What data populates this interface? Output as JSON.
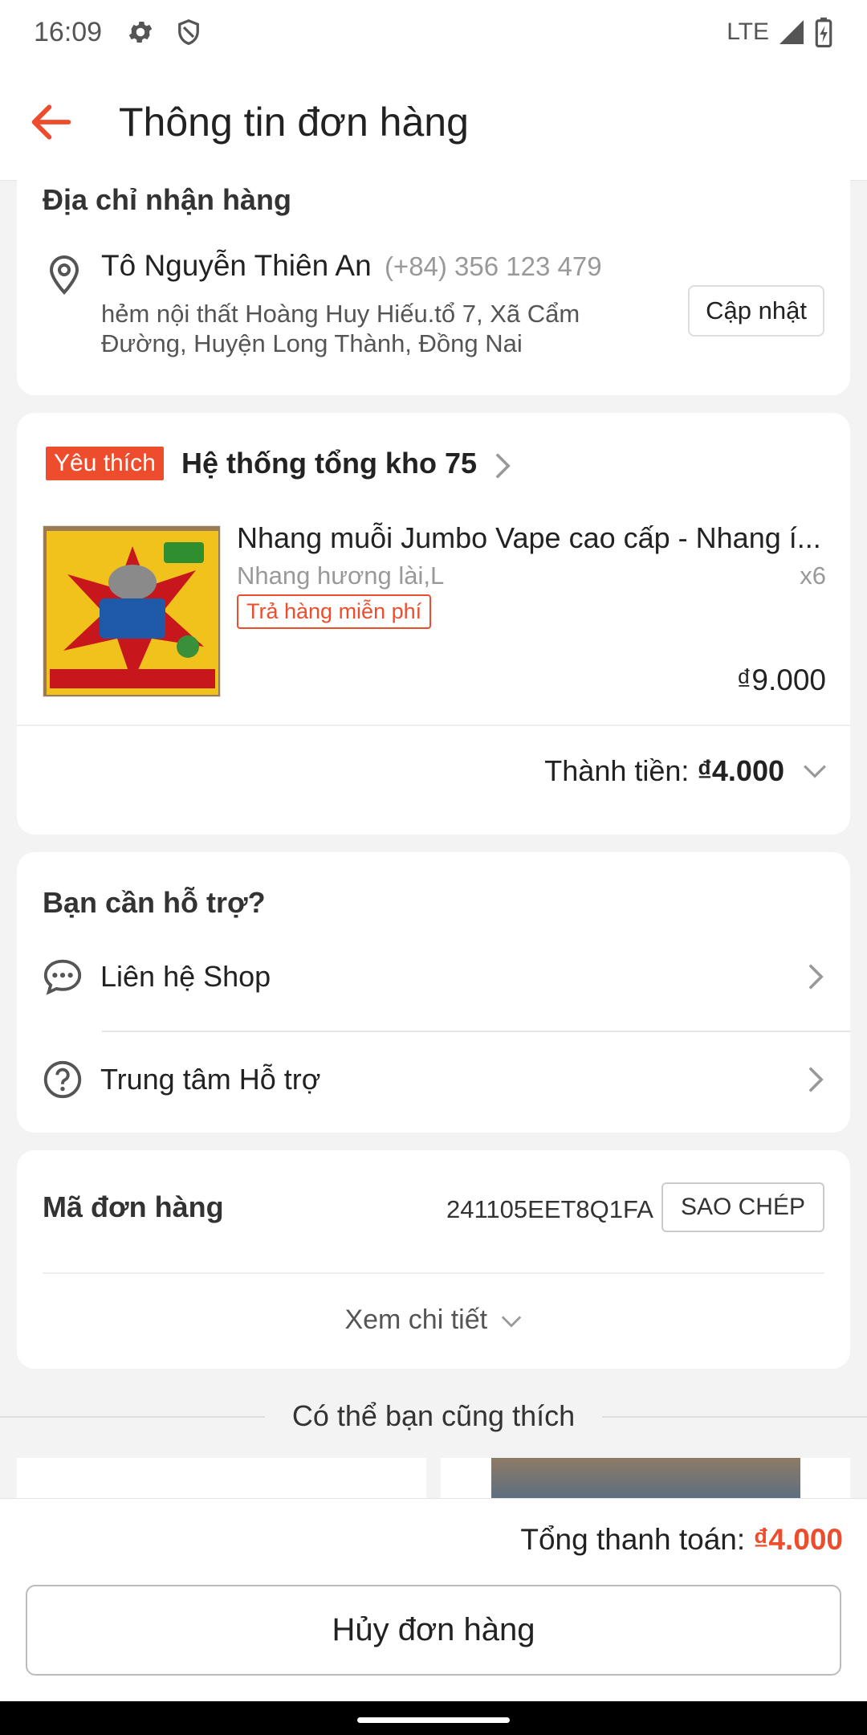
{
  "status_bar": {
    "time": "16:09",
    "network": "LTE"
  },
  "header": {
    "title": "Thông tin đơn hàng"
  },
  "address": {
    "heading": "Địa chỉ nhận hàng",
    "name": "Tô Nguyễn Thiên An",
    "phone": "(+84) 356 123 479",
    "line": "hẻm nội thất Hoàng Huy Hiếu.tổ 7, Xã Cẩm Đường, Huyện Long Thành, Đồng Nai",
    "update_label": "Cập nhật"
  },
  "shop": {
    "badge": "Yêu thích",
    "name": "Hệ thống tổng kho 75",
    "product": {
      "title": "Nhang muỗi Jumbo Vape cao cấp - Nhang í...",
      "variant": "Nhang hương lài,L",
      "qty": "x6",
      "return_tag": "Trả hàng miễn phí",
      "price": "₫9.000"
    },
    "total_label": "Thành tiền:",
    "total_value": "₫4.000"
  },
  "support": {
    "heading": "Bạn cần hỗ trợ?",
    "items": [
      {
        "label": "Liên hệ Shop",
        "icon": "chat-icon"
      },
      {
        "label": "Trung tâm Hỗ trợ",
        "icon": "help-icon"
      }
    ]
  },
  "order": {
    "label": "Mã đơn hàng",
    "code": "241105EET8Q1FA",
    "copy_label": "SAO CHÉP",
    "detail_label": "Xem chi tiết"
  },
  "suggestions": {
    "heading": "Có thể bạn cũng thích"
  },
  "footer": {
    "sum_label": "Tổng thanh toán:",
    "sum_value": "₫4.000",
    "cancel_label": "Hủy đơn hàng"
  },
  "colors": {
    "accent": "#ee4d2d",
    "background": "#f3f3f3"
  }
}
